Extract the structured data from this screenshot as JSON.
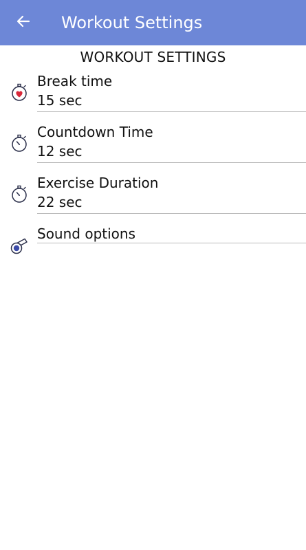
{
  "app_bar": {
    "title": "Workout Settings",
    "back_icon": "arrow-left-icon",
    "background_color": "#6d87d7",
    "text_color": "#ffffff"
  },
  "section_title": "WORKOUT SETTINGS",
  "settings": [
    {
      "label": "Break time",
      "value": "15 sec",
      "icon": "heart-stopwatch-icon"
    },
    {
      "label": "Countdown Time",
      "value": "12 sec",
      "icon": "stopwatch-icon"
    },
    {
      "label": "Exercise Duration",
      "value": "22 sec",
      "icon": "stopwatch-icon"
    },
    {
      "label": "Sound options",
      "icon": "whistle-icon"
    }
  ],
  "colors": {
    "accent": "#6d87d7",
    "heart": "#d8283a",
    "icon_stroke": "#2b2f4a",
    "whistle_fill": "#3b4aa8",
    "divider": "#b9b9b9"
  }
}
